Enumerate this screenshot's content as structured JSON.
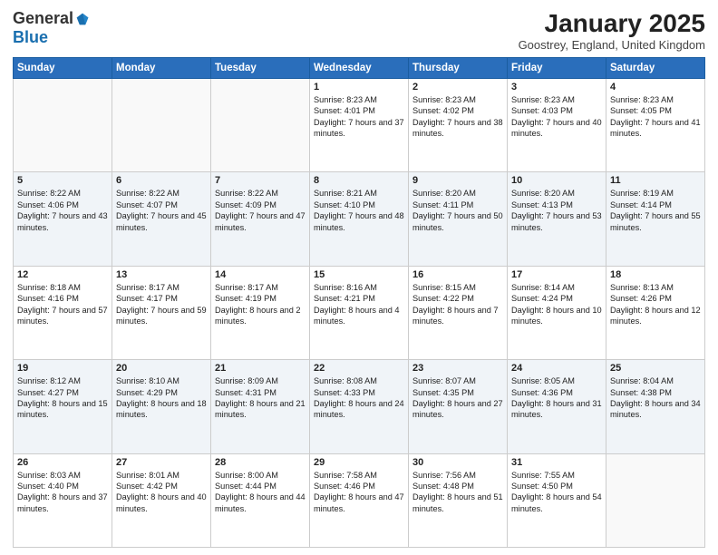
{
  "header": {
    "logo_general": "General",
    "logo_blue": "Blue",
    "month_title": "January 2025",
    "location": "Goostrey, England, United Kingdom"
  },
  "weekdays": [
    "Sunday",
    "Monday",
    "Tuesday",
    "Wednesday",
    "Thursday",
    "Friday",
    "Saturday"
  ],
  "weeks": [
    [
      {
        "day": "",
        "sunrise": "",
        "sunset": "",
        "daylight": "",
        "empty": true
      },
      {
        "day": "",
        "sunrise": "",
        "sunset": "",
        "daylight": "",
        "empty": true
      },
      {
        "day": "",
        "sunrise": "",
        "sunset": "",
        "daylight": "",
        "empty": true
      },
      {
        "day": "1",
        "sunrise": "Sunrise: 8:23 AM",
        "sunset": "Sunset: 4:01 PM",
        "daylight": "Daylight: 7 hours and 37 minutes."
      },
      {
        "day": "2",
        "sunrise": "Sunrise: 8:23 AM",
        "sunset": "Sunset: 4:02 PM",
        "daylight": "Daylight: 7 hours and 38 minutes."
      },
      {
        "day": "3",
        "sunrise": "Sunrise: 8:23 AM",
        "sunset": "Sunset: 4:03 PM",
        "daylight": "Daylight: 7 hours and 40 minutes."
      },
      {
        "day": "4",
        "sunrise": "Sunrise: 8:23 AM",
        "sunset": "Sunset: 4:05 PM",
        "daylight": "Daylight: 7 hours and 41 minutes."
      }
    ],
    [
      {
        "day": "5",
        "sunrise": "Sunrise: 8:22 AM",
        "sunset": "Sunset: 4:06 PM",
        "daylight": "Daylight: 7 hours and 43 minutes."
      },
      {
        "day": "6",
        "sunrise": "Sunrise: 8:22 AM",
        "sunset": "Sunset: 4:07 PM",
        "daylight": "Daylight: 7 hours and 45 minutes."
      },
      {
        "day": "7",
        "sunrise": "Sunrise: 8:22 AM",
        "sunset": "Sunset: 4:09 PM",
        "daylight": "Daylight: 7 hours and 47 minutes."
      },
      {
        "day": "8",
        "sunrise": "Sunrise: 8:21 AM",
        "sunset": "Sunset: 4:10 PM",
        "daylight": "Daylight: 7 hours and 48 minutes."
      },
      {
        "day": "9",
        "sunrise": "Sunrise: 8:20 AM",
        "sunset": "Sunset: 4:11 PM",
        "daylight": "Daylight: 7 hours and 50 minutes."
      },
      {
        "day": "10",
        "sunrise": "Sunrise: 8:20 AM",
        "sunset": "Sunset: 4:13 PM",
        "daylight": "Daylight: 7 hours and 53 minutes."
      },
      {
        "day": "11",
        "sunrise": "Sunrise: 8:19 AM",
        "sunset": "Sunset: 4:14 PM",
        "daylight": "Daylight: 7 hours and 55 minutes."
      }
    ],
    [
      {
        "day": "12",
        "sunrise": "Sunrise: 8:18 AM",
        "sunset": "Sunset: 4:16 PM",
        "daylight": "Daylight: 7 hours and 57 minutes."
      },
      {
        "day": "13",
        "sunrise": "Sunrise: 8:17 AM",
        "sunset": "Sunset: 4:17 PM",
        "daylight": "Daylight: 7 hours and 59 minutes."
      },
      {
        "day": "14",
        "sunrise": "Sunrise: 8:17 AM",
        "sunset": "Sunset: 4:19 PM",
        "daylight": "Daylight: 8 hours and 2 minutes."
      },
      {
        "day": "15",
        "sunrise": "Sunrise: 8:16 AM",
        "sunset": "Sunset: 4:21 PM",
        "daylight": "Daylight: 8 hours and 4 minutes."
      },
      {
        "day": "16",
        "sunrise": "Sunrise: 8:15 AM",
        "sunset": "Sunset: 4:22 PM",
        "daylight": "Daylight: 8 hours and 7 minutes."
      },
      {
        "day": "17",
        "sunrise": "Sunrise: 8:14 AM",
        "sunset": "Sunset: 4:24 PM",
        "daylight": "Daylight: 8 hours and 10 minutes."
      },
      {
        "day": "18",
        "sunrise": "Sunrise: 8:13 AM",
        "sunset": "Sunset: 4:26 PM",
        "daylight": "Daylight: 8 hours and 12 minutes."
      }
    ],
    [
      {
        "day": "19",
        "sunrise": "Sunrise: 8:12 AM",
        "sunset": "Sunset: 4:27 PM",
        "daylight": "Daylight: 8 hours and 15 minutes."
      },
      {
        "day": "20",
        "sunrise": "Sunrise: 8:10 AM",
        "sunset": "Sunset: 4:29 PM",
        "daylight": "Daylight: 8 hours and 18 minutes."
      },
      {
        "day": "21",
        "sunrise": "Sunrise: 8:09 AM",
        "sunset": "Sunset: 4:31 PM",
        "daylight": "Daylight: 8 hours and 21 minutes."
      },
      {
        "day": "22",
        "sunrise": "Sunrise: 8:08 AM",
        "sunset": "Sunset: 4:33 PM",
        "daylight": "Daylight: 8 hours and 24 minutes."
      },
      {
        "day": "23",
        "sunrise": "Sunrise: 8:07 AM",
        "sunset": "Sunset: 4:35 PM",
        "daylight": "Daylight: 8 hours and 27 minutes."
      },
      {
        "day": "24",
        "sunrise": "Sunrise: 8:05 AM",
        "sunset": "Sunset: 4:36 PM",
        "daylight": "Daylight: 8 hours and 31 minutes."
      },
      {
        "day": "25",
        "sunrise": "Sunrise: 8:04 AM",
        "sunset": "Sunset: 4:38 PM",
        "daylight": "Daylight: 8 hours and 34 minutes."
      }
    ],
    [
      {
        "day": "26",
        "sunrise": "Sunrise: 8:03 AM",
        "sunset": "Sunset: 4:40 PM",
        "daylight": "Daylight: 8 hours and 37 minutes."
      },
      {
        "day": "27",
        "sunrise": "Sunrise: 8:01 AM",
        "sunset": "Sunset: 4:42 PM",
        "daylight": "Daylight: 8 hours and 40 minutes."
      },
      {
        "day": "28",
        "sunrise": "Sunrise: 8:00 AM",
        "sunset": "Sunset: 4:44 PM",
        "daylight": "Daylight: 8 hours and 44 minutes."
      },
      {
        "day": "29",
        "sunrise": "Sunrise: 7:58 AM",
        "sunset": "Sunset: 4:46 PM",
        "daylight": "Daylight: 8 hours and 47 minutes."
      },
      {
        "day": "30",
        "sunrise": "Sunrise: 7:56 AM",
        "sunset": "Sunset: 4:48 PM",
        "daylight": "Daylight: 8 hours and 51 minutes."
      },
      {
        "day": "31",
        "sunrise": "Sunrise: 7:55 AM",
        "sunset": "Sunset: 4:50 PM",
        "daylight": "Daylight: 8 hours and 54 minutes."
      },
      {
        "day": "",
        "sunrise": "",
        "sunset": "",
        "daylight": "",
        "empty": true
      }
    ]
  ]
}
